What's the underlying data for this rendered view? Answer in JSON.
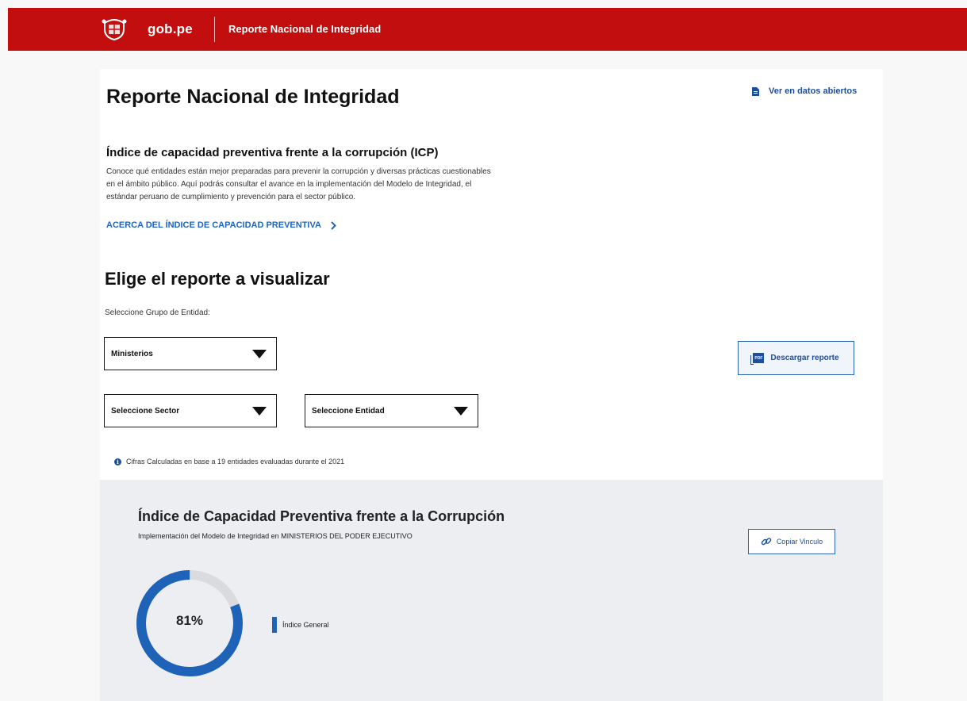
{
  "header": {
    "logo_text": "gob.pe",
    "title": "Reporte Nacional de Integridad",
    "logo_icon": "coat-of-arms-icon"
  },
  "main": {
    "page_title": "Reporte Nacional de Integridad",
    "open_data_link": "Ver en datos abiertos",
    "section_title": "Índice de capacidad preventiva frente a la corrupción (ICP)",
    "description": "Conoce qué entidades están mejor preparadas para prevenir la corrupción y diversas prácticas cuestionables en el ámbito público. Aquí podrás consultar el avance en la implementación del Modelo de Integridad, el estándar peruano de cumplimiento y prevención para el sector público.",
    "about_link": "ACERCA DEL ÍNDICE DE CAPACIDAD PREVENTIVA",
    "choose_title": "Elige el reporte a visualizar",
    "group_label": "Seleccione Grupo de Entidad:",
    "group_select": "Ministerios",
    "sector_select": "Seleccione Sector",
    "entity_select": "Seleccione Entidad",
    "download_button": "Descargar reporte",
    "pdf_icon_text": "PDF",
    "note": "Cifras Calculadas en base a 19 entidades evaluadas durante el 2021"
  },
  "icp": {
    "title": "Índice de Capacidad Preventiva frente a la Corrupción",
    "subtitle": "Implementación del Modelo de Integridad en MINISTERIOS DEL PODER EJECUTIVO",
    "copy_button": "Copiar Vinculo",
    "donut_label": "81%",
    "legend": "Índice General"
  },
  "chart_data": {
    "type": "pie",
    "values": [
      81,
      19
    ],
    "categories": [
      "Índice General",
      ""
    ]
  },
  "colors": {
    "header_red": "#c20e0e",
    "accent_blue": "#1f63b8",
    "link_blue": "#1c4fa0",
    "donut_track": "#d9dbdf",
    "panel_bg": "#eceef2"
  }
}
